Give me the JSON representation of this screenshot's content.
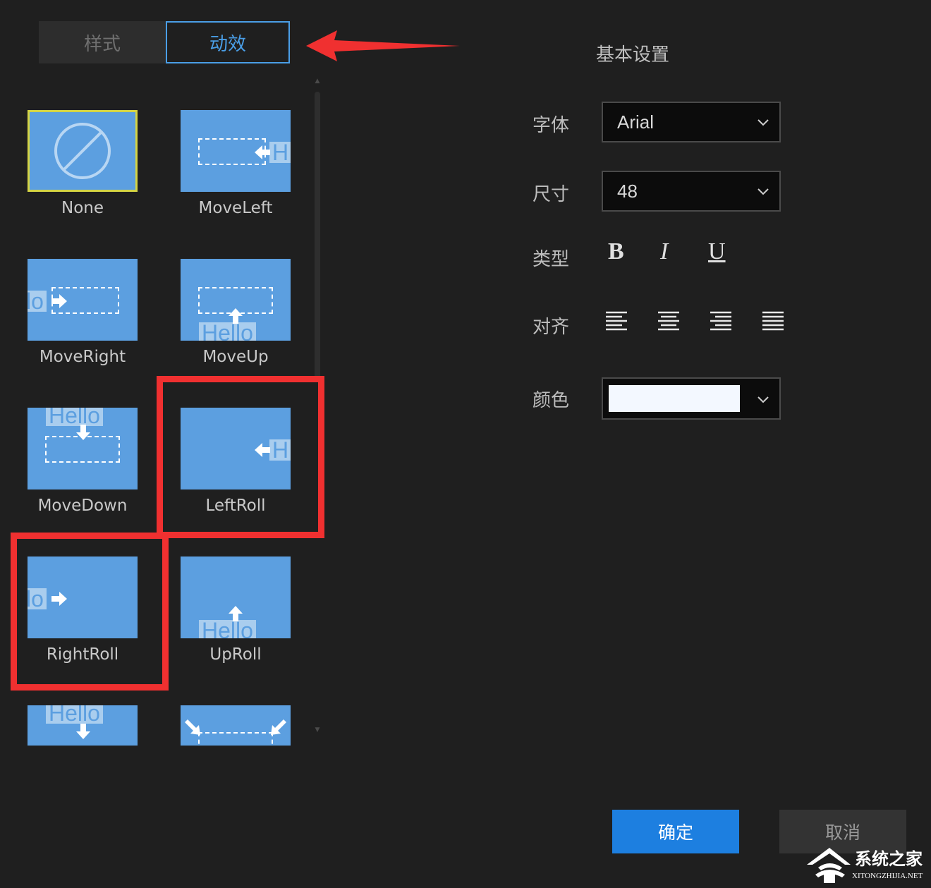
{
  "tabs": [
    {
      "label": "样式",
      "active": false
    },
    {
      "label": "动效",
      "active": true
    }
  ],
  "effects": [
    {
      "name": "None",
      "selected": true
    },
    {
      "name": "MoveLeft"
    },
    {
      "name": "MoveRight"
    },
    {
      "name": "MoveUp"
    },
    {
      "name": "MoveDown"
    },
    {
      "name": "LeftRoll",
      "highlighted": true
    },
    {
      "name": "RightRoll",
      "highlighted": true
    },
    {
      "name": "UpRoll"
    }
  ],
  "thumb_text": "Hello",
  "thumb_text_h": "H",
  "thumb_text_lo": "lo",
  "settings": {
    "title": "基本设置",
    "font_label": "字体",
    "font_value": "Arial",
    "size_label": "尺寸",
    "size_value": "48",
    "type_label": "类型",
    "bold": "B",
    "italic": "I",
    "underline": "U",
    "align_label": "对齐",
    "color_label": "颜色",
    "color_value": "#f3f8ff"
  },
  "buttons": {
    "ok": "确定",
    "cancel": "取消"
  },
  "watermark": {
    "text": "系统之家",
    "sub": "XITONGZHIJIA.NET"
  },
  "colors": {
    "background": "#1f1f1f",
    "accent": "#4a9ee6",
    "thumb": "#5c9fe0",
    "highlight": "#f03030",
    "selected_border": "#d4d444",
    "ok_button": "#1d7fe0"
  }
}
